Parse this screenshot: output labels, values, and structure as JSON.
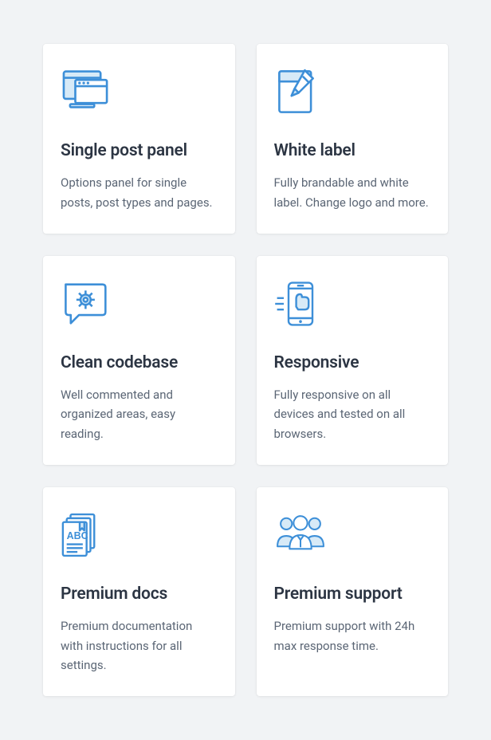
{
  "features": [
    {
      "title": "Single post panel",
      "desc": "Options panel for single posts, post types and pages.",
      "icon": "monitor-icon"
    },
    {
      "title": "White label",
      "desc": "Fully brandable and white label. Change logo and more.",
      "icon": "pencil-paper-icon"
    },
    {
      "title": "Clean codebase",
      "desc": "Well commented and organized areas, easy reading.",
      "icon": "chat-gear-icon"
    },
    {
      "title": "Responsive",
      "desc": "Fully responsive on all devices and tested on all browsers.",
      "icon": "mobile-thumb-icon"
    },
    {
      "title": "Premium docs",
      "desc": "Premium documentation with instructions for all settings.",
      "icon": "docs-icon"
    },
    {
      "title": "Premium support",
      "desc": "Premium support with 24h max response time.",
      "icon": "team-icon"
    }
  ],
  "colors": {
    "stroke": "#3d8fd8",
    "fill": "#d7eaf7",
    "page_bg": "#f1f3f5",
    "card_bg": "#ffffff",
    "title": "#2c3543",
    "text": "#5b6675"
  }
}
